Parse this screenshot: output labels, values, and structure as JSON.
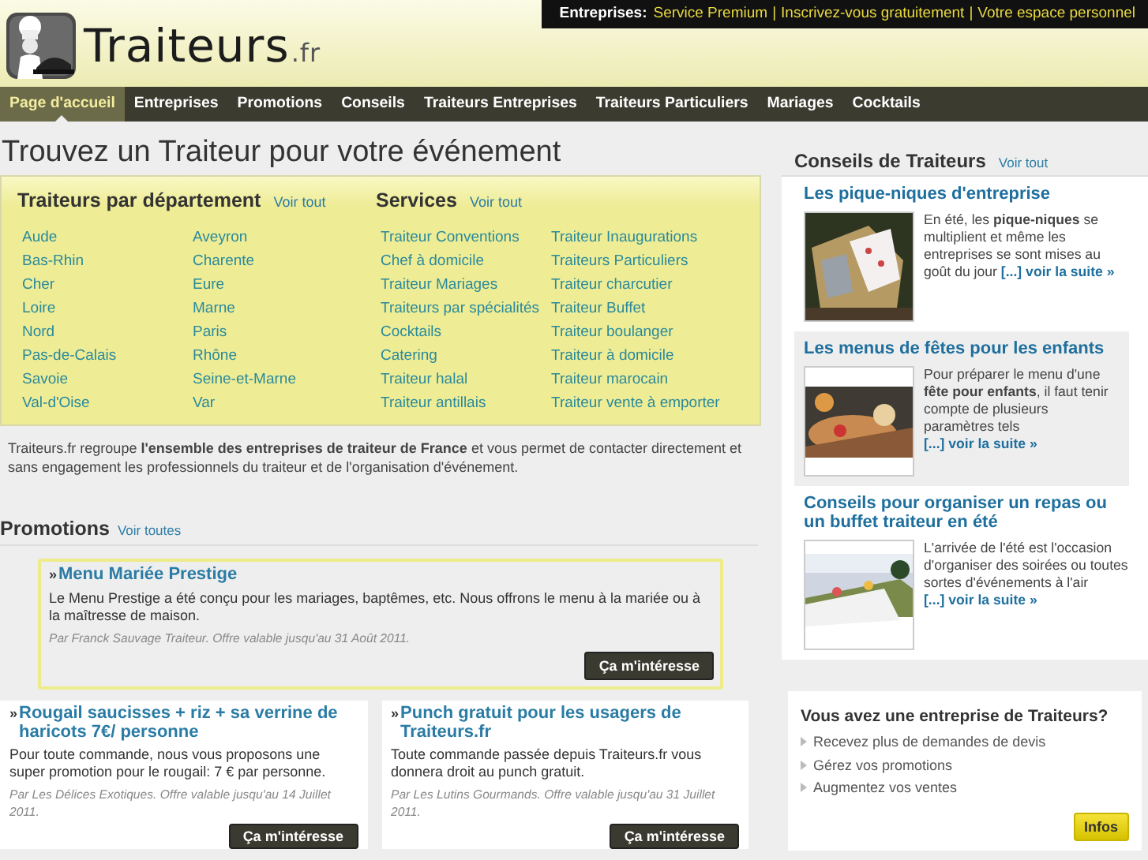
{
  "logo": {
    "name": "Traiteurs",
    "suffix": ".fr"
  },
  "top_bar": {
    "label": "Entreprises:",
    "separator": "|",
    "links": [
      "Service Premium",
      "Inscrivez-vous gratuitement",
      "Votre espace personnel"
    ]
  },
  "nav": [
    {
      "label": "Page d'accueil",
      "selected": true
    },
    {
      "label": "Entreprises",
      "selected": false
    },
    {
      "label": "Promotions",
      "selected": false
    },
    {
      "label": "Conseils",
      "selected": false
    },
    {
      "label": "Traiteurs Entreprises",
      "selected": false
    },
    {
      "label": "Traiteurs Particuliers",
      "selected": false
    },
    {
      "label": "Mariages",
      "selected": false
    },
    {
      "label": "Cocktails",
      "selected": false
    }
  ],
  "headline": "Trouvez un Traiteur pour votre événement",
  "directory": [
    {
      "title": "Traiteurs par département",
      "link": "Voir tout",
      "items": [
        "Aude",
        "Bas-Rhin",
        "Cher",
        "Loire",
        "Nord",
        "Pas-de-Calais",
        "Savoie",
        "Val-d'Oise",
        "Aveyron",
        "Charente",
        "Eure",
        "Marne",
        "Paris",
        "Rhône",
        "Seine-et-Marne",
        "Var"
      ]
    },
    {
      "title": "Services",
      "link": "Voir tout",
      "items": [
        "Traiteur Conventions",
        "Chef à domicile",
        "Traiteur Mariages",
        "Traiteurs par spécialités",
        "Cocktails",
        "Catering",
        "Traiteur halal",
        "Traiteur antillais",
        "Traiteur Inaugurations",
        "Traiteurs Particuliers",
        "Traiteur charcutier",
        "Traiteur Buffet",
        "Traiteur boulanger",
        "Traiteur à domicile",
        "Traiteur marocain",
        "Traiteur vente à emporter"
      ]
    }
  ],
  "intro": "Traiteurs.fr regroupe **l'ensemble des entreprises de traiteur de France** et vous permet de contacter directement et sans engagement les professionnels du traiteur et de l'organisation d'événement.",
  "promotions": {
    "title": "Promotions",
    "link": "Voir toutes",
    "items": [
      {
        "featured": true,
        "bullet": "»",
        "title": "Menu Mariée Prestige",
        "text": "Le Menu Prestige a été conçu pour les mariages, baptêmes, etc. Nous offrons le menu à la mariée ou à la maîtresse de maison.",
        "byline": "Par Franck Sauvage Traiteur. Offre valable jusqu'au 31 Août 2011.",
        "button": "Ça m'intéresse"
      },
      {
        "featured": false,
        "bullet": "»",
        "title": "Rougail saucisses + riz + sa verrine de haricots 7€/ personne",
        "text": "Pour toute commande, nous vous proposons une super promotion pour le rougail: 7 € par personne.",
        "byline": "Par Les Délices Exotiques. Offre valable jusqu'au 14 Juillet 2011.",
        "button": "Ça m'intéresse"
      },
      {
        "featured": false,
        "bullet": "»",
        "title": "Punch gratuit pour les usagers de Traiteurs.fr",
        "text": "Toute commande passée depuis Traiteurs.fr vous donnera droit au punch gratuit.",
        "byline": "Par Les Lutins Gourmands. Offre valable jusqu'au 31 Juillet 2011.",
        "button": "Ça m'intéresse"
      }
    ]
  },
  "advice": {
    "title": "Conseils de Traiteurs",
    "link": "Voir tout",
    "items": [
      {
        "highlighted": false,
        "title": "Les pique-niques d'entreprise",
        "text": "En été, les **pique-niques** se multiplient et même les entreprises se sont mises au goût du jour",
        "more": "[...] voir la suite »"
      },
      {
        "highlighted": true,
        "title": "Les menus de fêtes pour les enfants",
        "text": "Pour préparer le menu d'une **fête pour enfants**, il faut tenir compte de plusieurs paramètres tels",
        "more": "[...] voir la suite »"
      },
      {
        "highlighted": false,
        "title": "Conseils pour organiser un repas ou un buffet traiteur en été",
        "text": "L'arrivée de l'été est l'occasion d'organiser des soirées ou toutes sortes d'événements à l'air",
        "more": "[...] voir la suite »"
      }
    ]
  },
  "pro_box": {
    "title": "Vous avez une entreprise de Traiteurs?",
    "items": [
      "Recevez plus de demandes de devis",
      "Gérez vos promotions",
      "Augmentez vos ventes"
    ],
    "button": "Infos"
  }
}
